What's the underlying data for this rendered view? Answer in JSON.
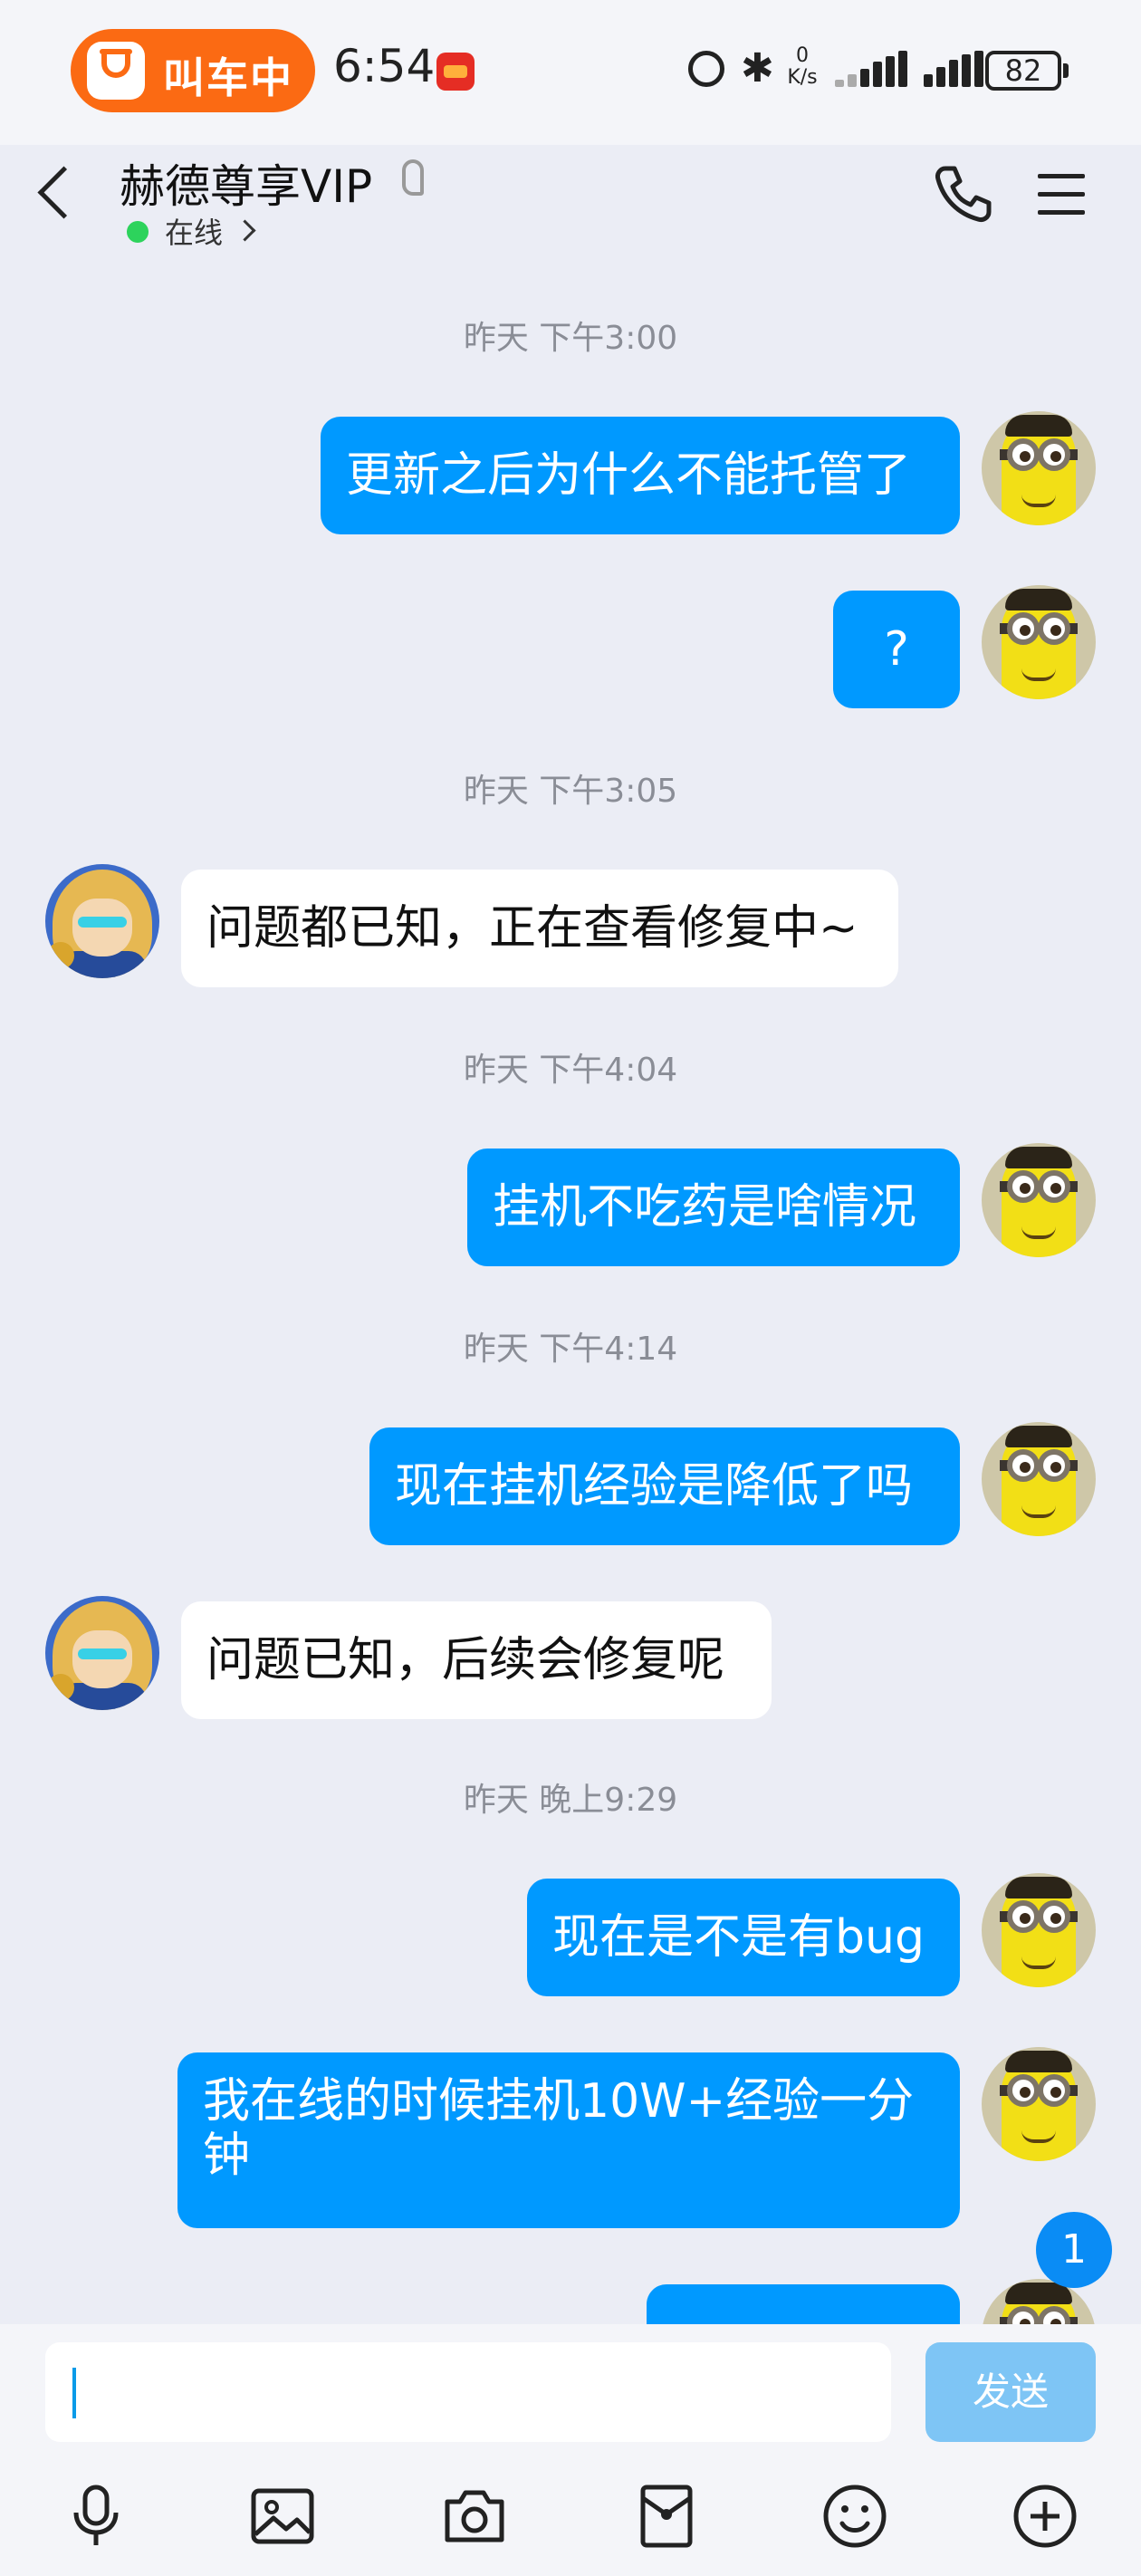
{
  "status_bar": {
    "ride_label": "叫车中",
    "time": "6:54",
    "net_speed_value": "0",
    "net_speed_unit": "K/s",
    "battery": "82"
  },
  "header": {
    "title": "赫德尊享VIP",
    "status": "在线"
  },
  "messages": [
    {
      "type": "time",
      "text": "昨天 下午3:00"
    },
    {
      "type": "msg",
      "side": "out",
      "text": "更新之后为什么不能托管了"
    },
    {
      "type": "msg",
      "side": "out",
      "text": "?"
    },
    {
      "type": "time",
      "text": "昨天 下午3:05"
    },
    {
      "type": "msg",
      "side": "in",
      "text": "问题都已知，正在查看修复中~"
    },
    {
      "type": "time",
      "text": "昨天 下午4:04"
    },
    {
      "type": "msg",
      "side": "out",
      "text": "挂机不吃药是啥情况"
    },
    {
      "type": "time",
      "text": "昨天 下午4:14"
    },
    {
      "type": "msg",
      "side": "out",
      "text": "现在挂机经验是降低了吗"
    },
    {
      "type": "msg",
      "side": "in",
      "text": "问题已知，后续会修复呢"
    },
    {
      "type": "time",
      "text": "昨天 晚上9:29"
    },
    {
      "type": "msg",
      "side": "out",
      "text": "现在是不是有bug"
    },
    {
      "type": "msg",
      "side": "out",
      "text_line1": "我在线的时候挂机10W+经验一分",
      "text_line2": "钟"
    }
  ],
  "unread_badge": "1",
  "input": {
    "value": "",
    "send_label": "发送"
  },
  "toolbar_icons": [
    "microphone-icon",
    "image-icon",
    "camera-icon",
    "red-packet-icon",
    "emoji-icon",
    "plus-icon"
  ],
  "colors": {
    "outgoing_bubble": "#0099ff",
    "incoming_bubble": "#ffffff",
    "background": "#ebedf5",
    "send_button_disabled": "#7ec5f5",
    "online": "#2dd35c",
    "ride_pill": "#fb6a13"
  }
}
